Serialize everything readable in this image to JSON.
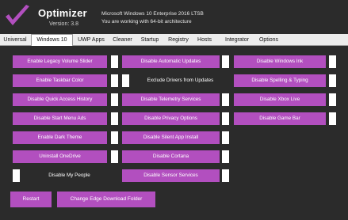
{
  "header": {
    "title": "Optimizer",
    "version": "Version: 3.8",
    "system_line1": "Microsoft Windows 10 Enterprise 2016 LTSB",
    "system_line2": "You are working with 64-bit architecture"
  },
  "tabs": [
    "Universal",
    "Windows 10",
    "UWP Apps",
    "Cleaner",
    "Startup",
    "Registry",
    "Hosts",
    "Integrator",
    "Options"
  ],
  "active_tab": "Windows 10",
  "columns": [
    [
      {
        "label": "Enable Legacy Volume Slider",
        "checked": true
      },
      {
        "label": "Enable Taskbar Color",
        "checked": true
      },
      {
        "label": "Disable Quick Access History",
        "checked": true
      },
      {
        "label": "Disable Start Menu Ads",
        "checked": true
      },
      {
        "label": "Enable Dark Theme",
        "checked": true
      },
      {
        "label": "Uninstall OneDrive",
        "checked": true
      },
      {
        "label": "Disable My People",
        "checked": false
      }
    ],
    [
      {
        "label": "Disable Automatic Updates",
        "checked": true
      },
      {
        "label": "Exclude Drivers from Updates",
        "checked": false
      },
      {
        "label": "Disable Telemetry Services",
        "checked": true
      },
      {
        "label": "Disable Privacy Options",
        "checked": true
      },
      {
        "label": "Disable Silent App Install",
        "checked": true
      },
      {
        "label": "Disable Cortana",
        "checked": true
      },
      {
        "label": "Disable Sensor Services",
        "checked": true
      }
    ],
    [
      {
        "label": "Disable Windows Ink",
        "checked": true
      },
      {
        "label": "Disable Spelling & Typing",
        "checked": true
      },
      {
        "label": "Disable Xbox Live",
        "checked": true
      },
      {
        "label": "Disable Game Bar",
        "checked": true
      }
    ]
  ],
  "buttons": {
    "restart": "Restart",
    "change_edge": "Change Edge Download Folder"
  },
  "colors": {
    "accent": "#b24fbf",
    "background": "#2b2b2b",
    "checkbox": "#ffffff"
  }
}
